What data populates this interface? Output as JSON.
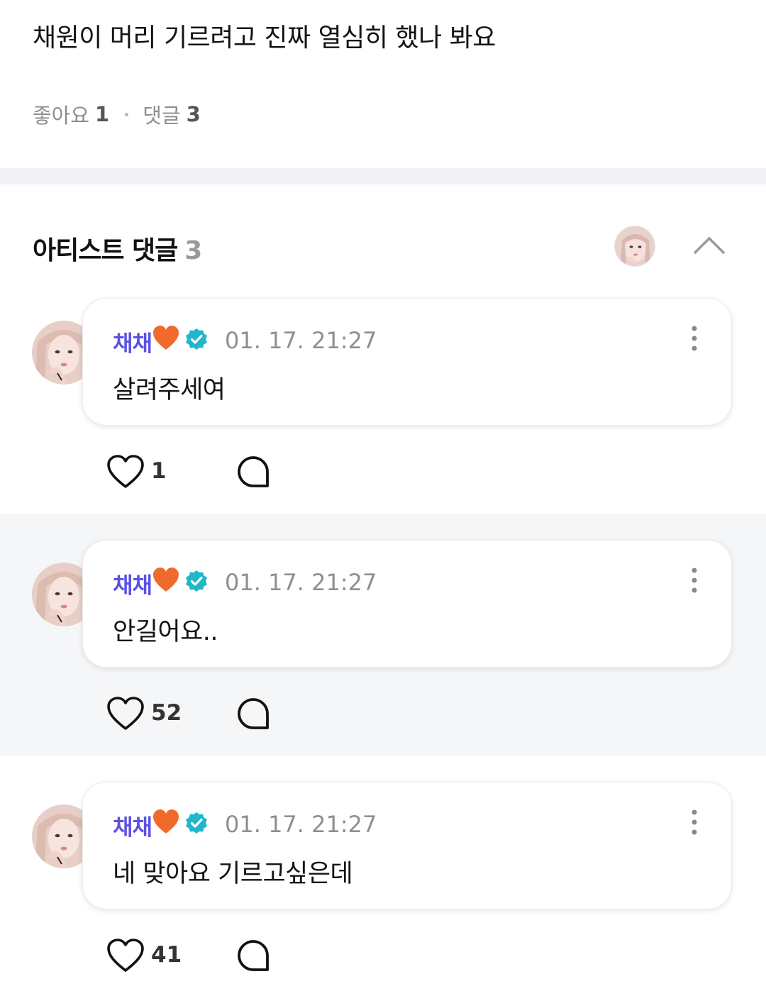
{
  "post": {
    "text": "채원이 머리 기르려고 진짜 열심히 했나 봐요",
    "likes_label": "좋아요",
    "likes_count": "1",
    "comments_label": "댓글",
    "comments_count": "3"
  },
  "artist_comments": {
    "title": "아티스트 댓글",
    "count": "3",
    "header_avatar_icon": "artist-avatar",
    "collapse_icon": "chevron-up-icon"
  },
  "comments": [
    {
      "author": "채채",
      "time": "01. 17. 21:27",
      "text": "살려주세여",
      "likes": "1"
    },
    {
      "author": "채채",
      "time": "01. 17. 21:27",
      "text": "안길어요..",
      "likes": "52"
    },
    {
      "author": "채채",
      "time": "01. 17. 21:27",
      "text": "네 맞아요 기르고싶은데",
      "likes": "41"
    }
  ],
  "colors": {
    "author": "#5b50e6",
    "verified_badge": "#1fb7c9",
    "heart_emoji": "#f06a2b",
    "shaded_bg": "#f5f6f8"
  }
}
